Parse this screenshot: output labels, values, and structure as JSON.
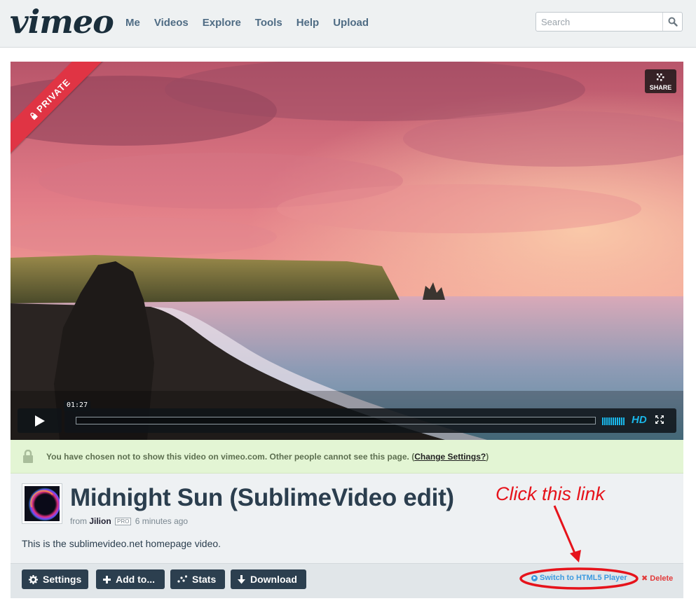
{
  "header": {
    "logo": "vimeo",
    "nav": [
      "Me",
      "Videos",
      "Explore",
      "Tools",
      "Help",
      "Upload"
    ],
    "search_placeholder": "Search"
  },
  "player": {
    "badge": "PRIVATE",
    "share_label": "SHARE",
    "timecode": "01:27",
    "hd_label": "HD",
    "progress_fraction": 0,
    "accent_color": "#1ab7ea"
  },
  "notice": {
    "message": "You have chosen not to show this video on vimeo.com. Other people cannot see this page. (",
    "link": "Change Settings?",
    "close": ")"
  },
  "video": {
    "title": "Midnight Sun (SublimeVideo edit)",
    "from_label": "from",
    "user": "Jilion",
    "pro_badge": "PRO",
    "time_ago": "6 minutes ago",
    "description": "This is the sublimevideo.net homepage video."
  },
  "actions": {
    "settings": "Settings",
    "add_to": "Add to...",
    "stats": "Stats",
    "download": "Download",
    "switch_player": "Switch to HTML5 Player",
    "delete": "Delete"
  },
  "annotation": {
    "text": "Click this link",
    "color": "#e6131b"
  }
}
